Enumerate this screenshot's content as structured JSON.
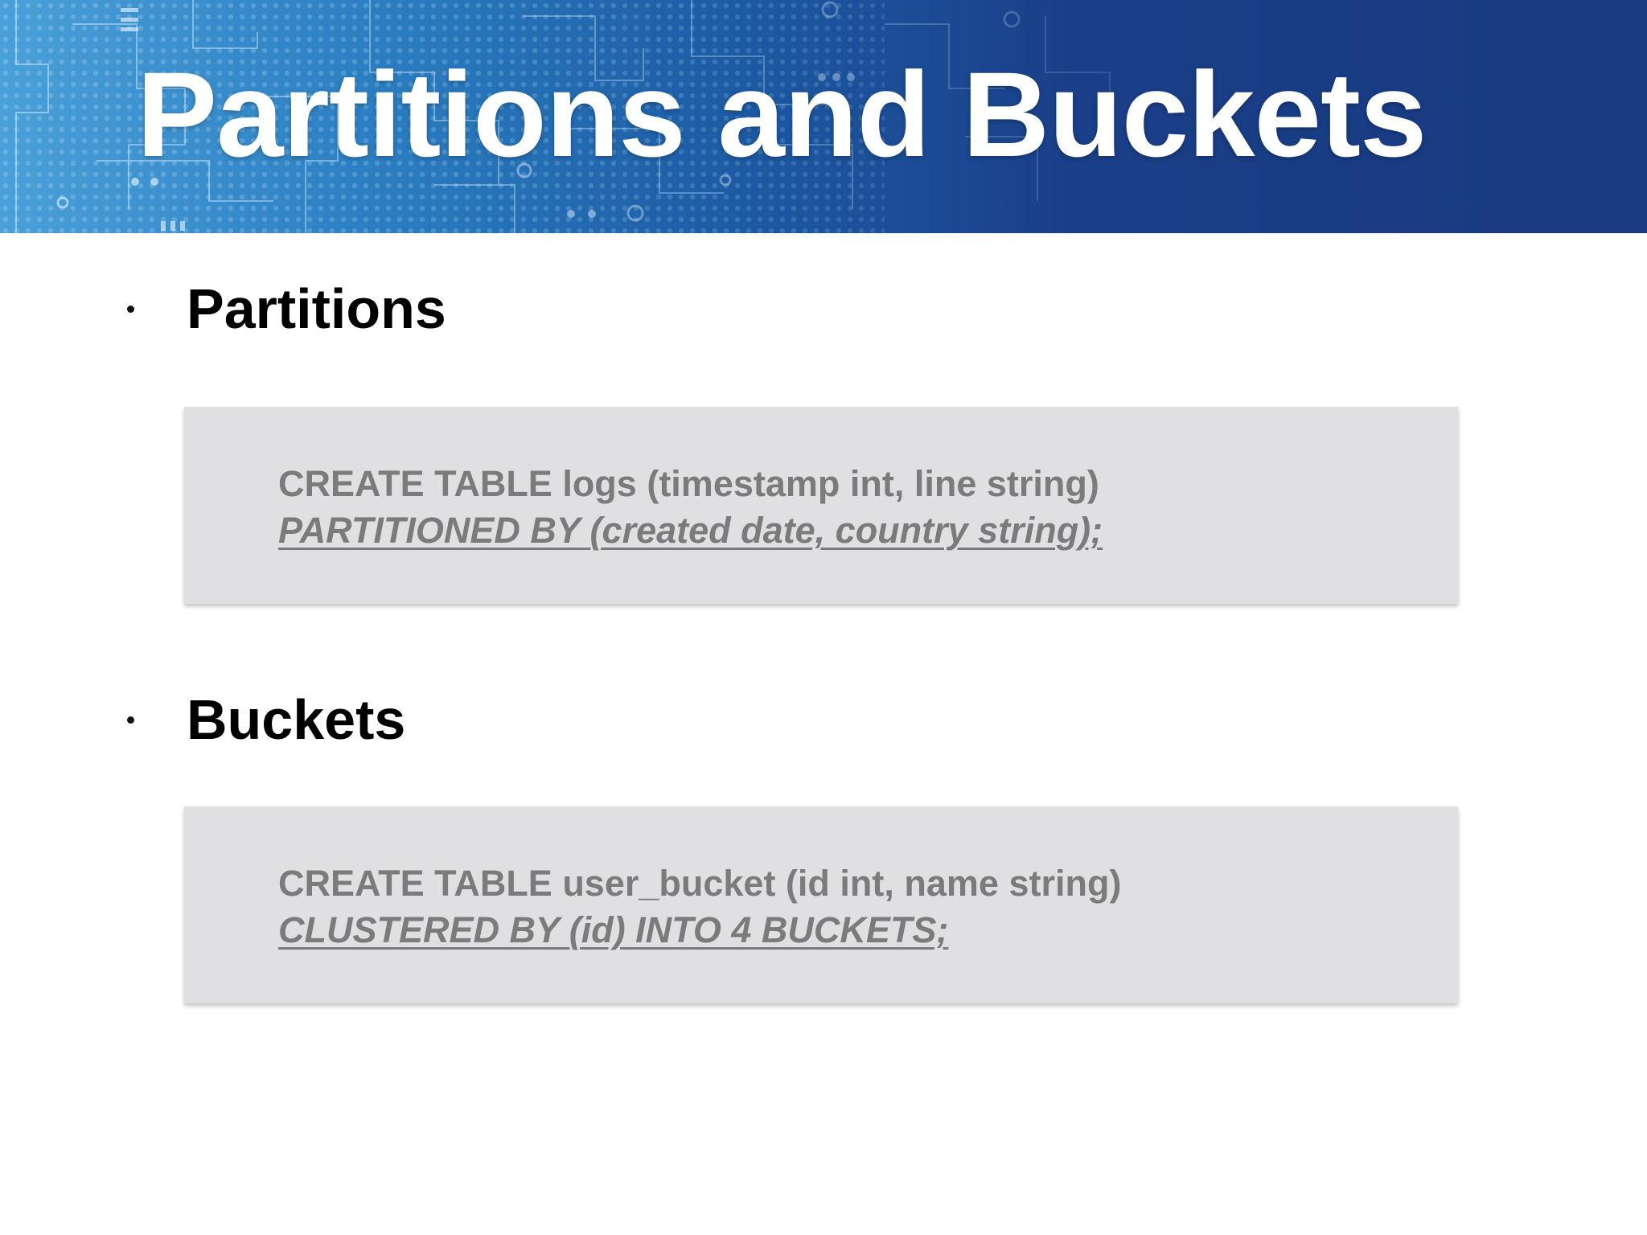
{
  "slide": {
    "title": "Partitions and Buckets"
  },
  "sections": [
    {
      "heading": "Partitions",
      "code": {
        "line1": "CREATE TABLE logs (timestamp int, line string)",
        "line2": "PARTITIONED BY (created date, country string);"
      }
    },
    {
      "heading": "Buckets",
      "code": {
        "line1": "CREATE TABLE user_bucket (id int, name string)",
        "line2": "CLUSTERED BY (id) INTO 4 BUCKETS;"
      }
    }
  ],
  "colors": {
    "banner_left": "#4aa0d8",
    "banner_right": "#183a80",
    "title_text": "#ffffff",
    "code_box_bg": "#e0e0e2",
    "code_text": "#7b7b7b"
  }
}
